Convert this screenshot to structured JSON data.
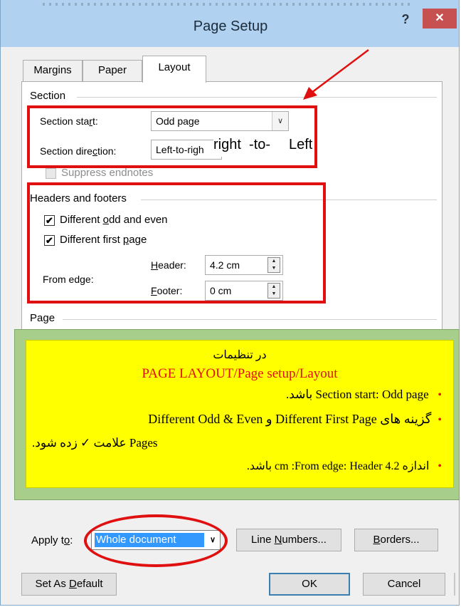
{
  "window": {
    "title": "Page Setup",
    "help": "?",
    "close": "✕"
  },
  "tabs": [
    {
      "label": "Margins",
      "active": false
    },
    {
      "label": "Paper",
      "active": false
    },
    {
      "label": "Layout",
      "active": true
    }
  ],
  "section": {
    "heading": "Section",
    "start_label_pre": "Section sta",
    "start_label_u": "r",
    "start_label_post": "t:",
    "start_value": "Odd page",
    "direction_label_pre": "Section dire",
    "direction_label_u": "c",
    "direction_label_post": "tion:",
    "direction_value": "Left-to-righ",
    "direction_overlay": {
      "a": "right",
      "b": "-to-",
      "c": "Left"
    },
    "suppress_endnotes": "Suppress endnotes"
  },
  "headers_footers": {
    "heading": "Headers and footers",
    "odd_even_pre": "Different ",
    "odd_even_u": "o",
    "odd_even_post": "dd and even",
    "odd_even_checked": "✔",
    "first_page_pre": "Different first ",
    "first_page_u": "p",
    "first_page_post": "age",
    "first_page_checked": "✔",
    "from_edge": "From edge:",
    "header_u": "H",
    "header_rest": "eader:",
    "header_value": "4.2 cm",
    "footer_u": "F",
    "footer_rest": "ooter:",
    "footer_value": "0 cm"
  },
  "page_group": {
    "heading": "Page"
  },
  "note": {
    "line1": "در تنظیمات",
    "line2": "PAGE LAYOUT/Page setup/Layout",
    "bullet1": "Section start: Odd page باشد.",
    "bullet2a": "گزینه های  Different First Page و  Different Odd & Even",
    "bullet2b": "Pages علامت ✓ زده شود.",
    "bullet3": "اندازه 4.2 cm :From edge: Header باشد.",
    "bullet_glyph": "•",
    "colors": {
      "title_red": "#e01010",
      "bg_yellow": "#ffff00",
      "bg_green": "#a7cf8b"
    }
  },
  "footer": {
    "apply_pre": "Apply t",
    "apply_u": "o",
    "apply_post": ":",
    "apply_value": "Whole document",
    "line_numbers_pre": "Line ",
    "line_numbers_u": "N",
    "line_numbers_post": "umbers...",
    "borders_u": "B",
    "borders_post": "orders...",
    "set_default_pre": "Set As ",
    "set_default_u": "D",
    "set_default_post": "efault",
    "ok": "OK",
    "cancel": "Cancel"
  }
}
